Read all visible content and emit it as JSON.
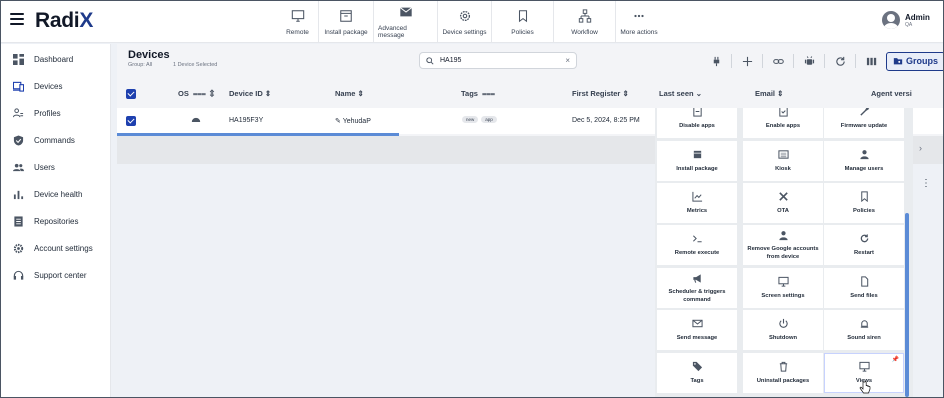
{
  "app": {
    "logo_main": "Radi",
    "logo_x": "X"
  },
  "toolbar": [
    {
      "label": "Remote",
      "icon": "monitor-icon"
    },
    {
      "label": "Install package",
      "icon": "package-icon"
    },
    {
      "label": "Advanced message",
      "icon": "envelope-icon"
    },
    {
      "label": "Device settings",
      "icon": "gear-icon"
    },
    {
      "label": "Policies",
      "icon": "bookmark-icon"
    },
    {
      "label": "Workflow",
      "icon": "workflow-icon"
    },
    {
      "label": "More actions",
      "icon": "more-icon"
    }
  ],
  "user": {
    "name": "Admin",
    "sub": "QA"
  },
  "sidebar": {
    "items": [
      {
        "label": "Dashboard",
        "icon": "dashboard-icon"
      },
      {
        "label": "Devices",
        "icon": "devices-icon"
      },
      {
        "label": "Profiles",
        "icon": "profiles-icon"
      },
      {
        "label": "Commands",
        "icon": "shield-icon"
      },
      {
        "label": "Users",
        "icon": "users-icon"
      },
      {
        "label": "Device health",
        "icon": "bar-chart-icon"
      },
      {
        "label": "Repositories",
        "icon": "repository-icon"
      },
      {
        "label": "Account settings",
        "icon": "gear-icon"
      },
      {
        "label": "Support center",
        "icon": "headset-icon"
      }
    ]
  },
  "devices": {
    "title": "Devices",
    "group": "Group: All",
    "selected": "1 Device Selected",
    "search_value": "HA195",
    "groups_button": "Groups",
    "columns": {
      "os": "OS",
      "device_id": "Device ID",
      "name": "Name",
      "tags": "Tags",
      "first_register": "First Register",
      "last_seen": "Last seen",
      "email": "Email",
      "agent_version": "Agent versi"
    },
    "row": {
      "device_id": "HA195F3Y",
      "name": "YehudaP",
      "tags": [
        "new",
        "app"
      ],
      "first_register": "Dec 5, 2024, 8:25 PM"
    }
  },
  "actions_menu": {
    "items": [
      {
        "label": "Disable apps",
        "icon": "disable-apps-icon"
      },
      {
        "label": "Enable apps",
        "icon": "enable-apps-icon"
      },
      {
        "label": "Firmware update",
        "icon": "firmware-icon"
      },
      {
        "label": "Install package",
        "icon": "package-icon"
      },
      {
        "label": "Kiosk",
        "icon": "kiosk-icon"
      },
      {
        "label": "Manage users",
        "icon": "user-icon"
      },
      {
        "label": "Metrics",
        "icon": "metrics-icon"
      },
      {
        "label": "OTA",
        "icon": "tools-icon"
      },
      {
        "label": "Policies",
        "icon": "bookmark-icon"
      },
      {
        "label": "Remote execute",
        "icon": "terminal-icon"
      },
      {
        "label": "Remove Google accounts from device",
        "icon": "user-icon"
      },
      {
        "label": "Restart",
        "icon": "restart-icon"
      },
      {
        "label": "Scheduler & triggers command",
        "icon": "megaphone-icon"
      },
      {
        "label": "Screen settings",
        "icon": "monitor-icon"
      },
      {
        "label": "Send files",
        "icon": "file-icon"
      },
      {
        "label": "Send message",
        "icon": "envelope-icon"
      },
      {
        "label": "Shutdown",
        "icon": "power-icon"
      },
      {
        "label": "Sound siren",
        "icon": "siren-icon"
      },
      {
        "label": "Tags",
        "icon": "tag-icon"
      },
      {
        "label": "Uninstall packages",
        "icon": "trash-icon"
      },
      {
        "label": "Views",
        "icon": "monitor-icon"
      }
    ]
  },
  "colors": {
    "brand": "#1e3a8a",
    "accent": "#1e40af",
    "progress": "#5b8bd6"
  }
}
